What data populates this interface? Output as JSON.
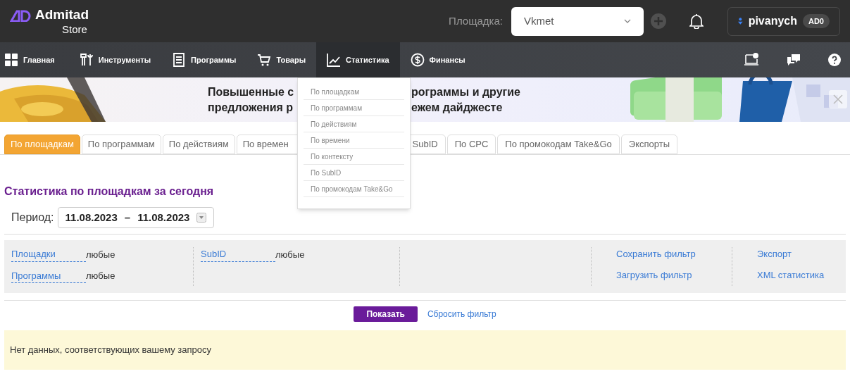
{
  "header": {
    "logo_name": "Admitad",
    "logo_sub": "Store",
    "platform_label": "Площадка:",
    "platform_value": "Vkmet",
    "user_name": "pivanych",
    "user_badge": "AD0"
  },
  "nav": [
    {
      "label": "Главная",
      "selected": false
    },
    {
      "label": "Инструменты",
      "selected": false
    },
    {
      "label": "Программы",
      "selected": false
    },
    {
      "label": "Товары",
      "selected": false
    },
    {
      "label": "Статистика",
      "selected": true
    },
    {
      "label": "Финансы",
      "selected": false
    }
  ],
  "stats_menu": [
    "По площадкам",
    "По программам",
    "По действиям",
    "По времени",
    "По контексту",
    "По SubID",
    "По промокодам Take&Go"
  ],
  "banner": {
    "lines": [
      {
        "before": "Повышенные с",
        "after": "рограммы и другие"
      },
      {
        "before": "предложения р",
        "after": "ежем дайджесте"
      }
    ]
  },
  "tabs": [
    {
      "label": "По площадкам",
      "selected": true
    },
    {
      "label": "По программам",
      "selected": false
    },
    {
      "label": "По действиям",
      "selected": false
    },
    {
      "label": "По времен",
      "selected": false
    },
    {
      "label": "SubID",
      "selected": false
    },
    {
      "label": "По CPC",
      "selected": false
    },
    {
      "label": "По промокодам Take&Go",
      "selected": false
    },
    {
      "label": "Экспорты",
      "selected": false
    }
  ],
  "report": {
    "title": "Статистика по площадкам за сегодня",
    "period_label": "Период:",
    "date_from": "11.08.2023",
    "date_separator": "–",
    "date_to": "11.08.2023"
  },
  "filter": {
    "columns": [
      {
        "kind": "fields",
        "items": [
          {
            "label": "Площадки",
            "value": "любые"
          },
          {
            "label": "Программы",
            "value": "любые"
          }
        ]
      },
      {
        "kind": "fields",
        "items": [
          {
            "label": "SubID",
            "value": "любые"
          }
        ]
      },
      {
        "kind": "empty"
      },
      {
        "kind": "links",
        "items": [
          "Сохранить фильтр",
          "Загрузить фильтр"
        ]
      },
      {
        "kind": "links",
        "items": [
          "Экспорт",
          "XML статистика"
        ]
      }
    ]
  },
  "actions": {
    "show": "Показать",
    "reset": "Сбросить фильтр"
  },
  "notice": "Нет данных, соответствующих вашему запросу"
}
